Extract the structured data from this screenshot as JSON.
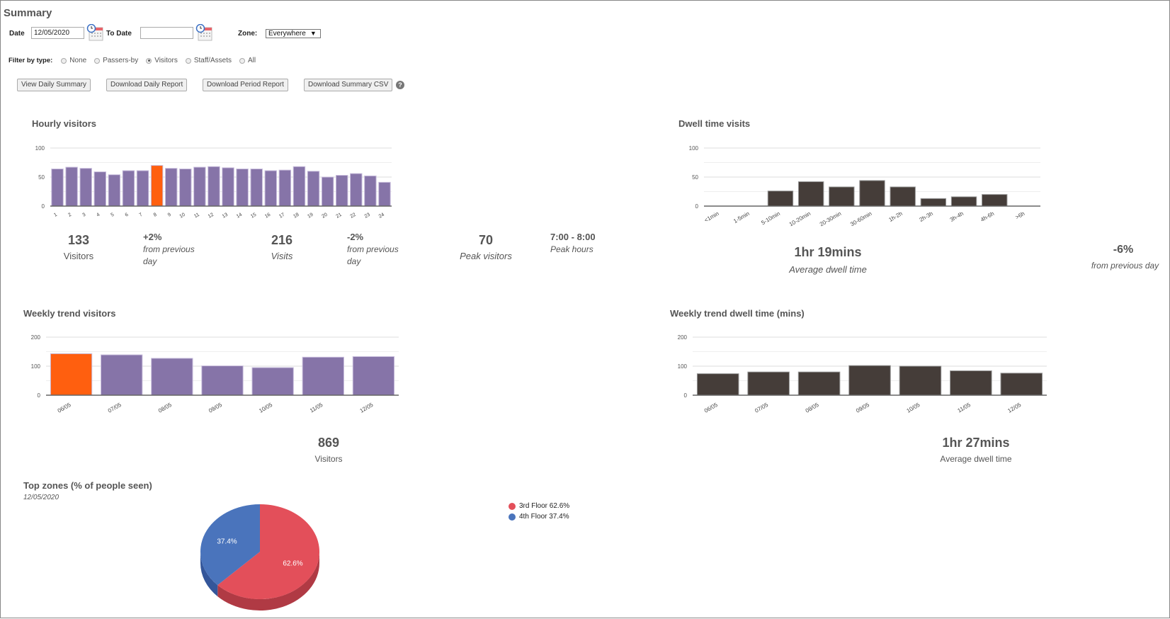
{
  "header": {
    "title": "Summary"
  },
  "filters": {
    "date_label": "Date",
    "date_value": "12/05/2020",
    "to_date_label": "To Date",
    "to_date_value": "",
    "zone_label": "Zone:",
    "zone_value": "Everywhere",
    "filter_label": "Filter by type:",
    "types": [
      {
        "label": "None",
        "selected": false
      },
      {
        "label": "Passers-by",
        "selected": false
      },
      {
        "label": "Visitors",
        "selected": true
      },
      {
        "label": "Staff/Assets",
        "selected": false
      },
      {
        "label": "All",
        "selected": false
      }
    ]
  },
  "buttons": {
    "view_daily": "View Daily Summary",
    "download_daily": "Download Daily Report",
    "download_period": "Download Period Report",
    "download_csv": "Download Summary CSV",
    "help": "?"
  },
  "hourly": {
    "title": "Hourly visitors",
    "stats": {
      "visitors_value": "133",
      "visitors_label": "Visitors",
      "visitors_change": "+2%",
      "visitors_change_label": "from previous day",
      "visits_value": "216",
      "visits_label": "Visits",
      "visits_change": "-2%",
      "visits_change_label": "from previous day",
      "peak_value": "70",
      "peak_label": "Peak visitors",
      "peak_hours_value": "7:00 - 8:00",
      "peak_hours_label": "Peak hours"
    }
  },
  "dwell": {
    "title": "Dwell time visits",
    "avg_value": "1hr 19mins",
    "avg_label": "Average dwell time",
    "change": "-6%",
    "change_label": "from previous day"
  },
  "weekly_visitors": {
    "title": "Weekly trend visitors",
    "total_value": "869",
    "total_label": "Visitors"
  },
  "weekly_dwell": {
    "title": "Weekly trend dwell time (mins)",
    "avg_value": "1hr 27mins",
    "avg_label": "Average dwell time"
  },
  "zones": {
    "title": "Top zones (% of people seen)",
    "date": "12/05/2020"
  },
  "colors": {
    "purple": "#8674a8",
    "orange": "#ff5f0f",
    "dark": "#453d39",
    "red": "#e34f5a",
    "blue": "#4a74bc"
  },
  "chart_data": [
    {
      "id": "hourly",
      "type": "bar",
      "title": "Hourly visitors",
      "categories": [
        "1",
        "2",
        "3",
        "4",
        "5",
        "6",
        "7",
        "8",
        "9",
        "10",
        "11",
        "12",
        "13",
        "14",
        "15",
        "16",
        "17",
        "18",
        "19",
        "20",
        "21",
        "22",
        "23",
        "24"
      ],
      "values": [
        64,
        67,
        65,
        59,
        54,
        61,
        61,
        70,
        65,
        64,
        67,
        68,
        66,
        64,
        64,
        61,
        62,
        68,
        60,
        50,
        53,
        56,
        52,
        41
      ],
      "highlight_index": 7,
      "yticks": [
        0,
        50,
        100
      ],
      "ylim": [
        0,
        100
      ],
      "grid": true
    },
    {
      "id": "dwell",
      "type": "bar",
      "title": "Dwell time visits",
      "categories": [
        "<1min",
        "1-5min",
        "5-10min",
        "10-20min",
        "20-30min",
        "30-60min",
        "1h-2h",
        "2h-3h",
        "3h-4h",
        "4h-6h",
        ">6h"
      ],
      "values": [
        0,
        0,
        26,
        42,
        33,
        44,
        33,
        13,
        16,
        20,
        0
      ],
      "yticks": [
        0,
        50,
        100
      ],
      "ylim": [
        0,
        100
      ],
      "grid": true
    },
    {
      "id": "weekly_visitors",
      "type": "bar",
      "title": "Weekly trend visitors",
      "categories": [
        "06/05",
        "07/05",
        "08/05",
        "09/05",
        "10/05",
        "11/05",
        "12/05"
      ],
      "values": [
        143,
        139,
        127,
        101,
        95,
        131,
        133
      ],
      "highlight_index": 0,
      "yticks": [
        0,
        100,
        200
      ],
      "ylim": [
        0,
        200
      ],
      "grid": true
    },
    {
      "id": "weekly_dwell",
      "type": "bar",
      "title": "Weekly trend dwell time (mins)",
      "categories": [
        "06/05",
        "07/05",
        "08/05",
        "09/05",
        "10/05",
        "11/05",
        "12/05"
      ],
      "values": [
        74,
        80,
        80,
        102,
        100,
        84,
        76
      ],
      "yticks": [
        0,
        100,
        200
      ],
      "ylim": [
        0,
        200
      ],
      "grid": true
    },
    {
      "id": "zones",
      "type": "pie",
      "title": "Top zones (% of people seen)",
      "subtitle": "12/05/2020",
      "slices": [
        {
          "label": "3rd Floor",
          "value": 62.6,
          "label_text": "62.6%",
          "legend": "3rd Floor 62.6%"
        },
        {
          "label": "4th Floor",
          "value": 37.4,
          "label_text": "37.4%",
          "legend": "4th Floor 37.4%"
        }
      ],
      "legend_position": "right"
    }
  ]
}
